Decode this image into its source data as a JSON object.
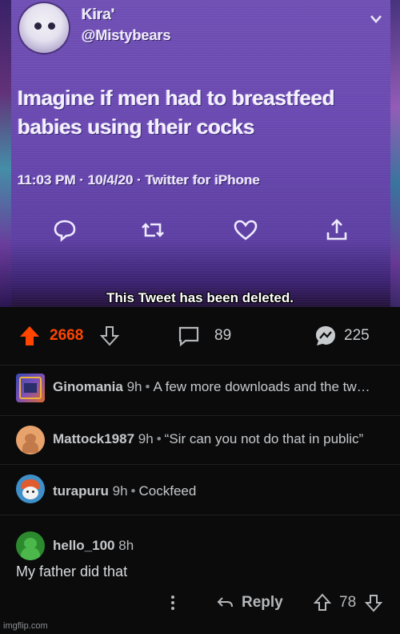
{
  "tweet": {
    "display_name": "Kira'",
    "handle": "@Mistybears",
    "text": "Imagine if men had to breastfeed babies using their cocks",
    "meta": "11:03 PM · 10/4/20 · Twitter for iPhone",
    "deleted_notice": "This Tweet has been deleted.",
    "icons": [
      "reply-icon",
      "retweet-icon",
      "like-icon",
      "share-icon",
      "chevron-down-icon"
    ]
  },
  "post_actions": {
    "score": "2668",
    "comments": "89",
    "awards": "225",
    "accent_color": "#ff4500"
  },
  "comments": [
    {
      "user": "Ginomania",
      "age": "9h",
      "body": "A few more downloads and the tw…"
    },
    {
      "user": "Mattock1987",
      "age": "9h",
      "body": "“Sir can you not do that in public”"
    },
    {
      "user": "turapuru",
      "age": "9h",
      "body": "Cockfeed"
    },
    {
      "user": "hello_100",
      "age": "8h",
      "body": "My father did that",
      "reply_label": "Reply",
      "score": "78"
    }
  ],
  "watermark": "imgflip.com"
}
